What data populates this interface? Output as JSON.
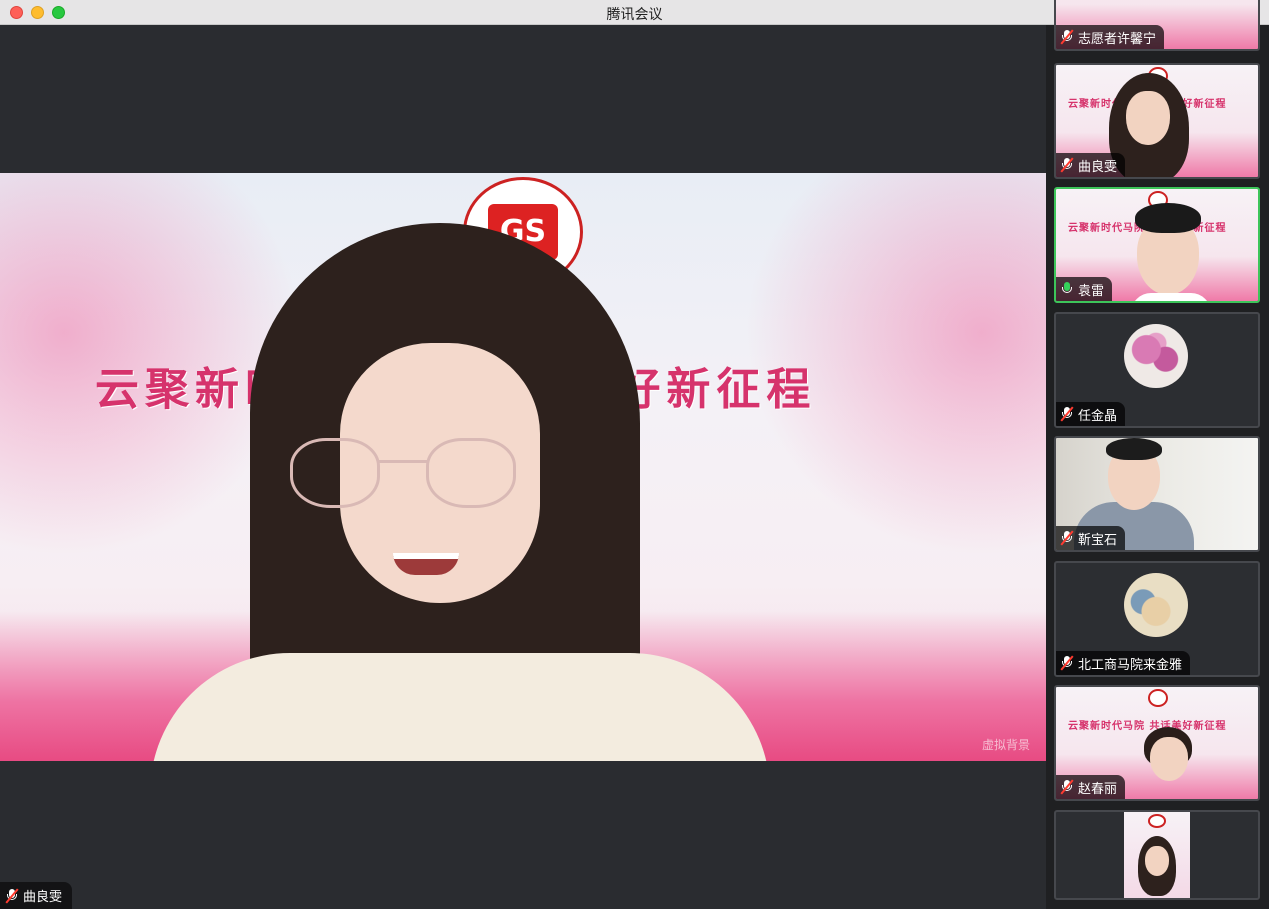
{
  "window": {
    "title": "腾讯会议"
  },
  "main_video": {
    "banner_text": "云聚新时代马院  共话美好新征程",
    "logo_text": "GS",
    "watermark": "虚拟背景",
    "speaker_name": "曲良雯",
    "speaker_muted": true
  },
  "participants": [
    {
      "name": "志愿者许馨宁",
      "muted": true,
      "video": "banner"
    },
    {
      "name": "曲良雯",
      "muted": true,
      "video": "banner-woman"
    },
    {
      "name": "袁雷",
      "muted": false,
      "speaking": true,
      "video": "banner-man"
    },
    {
      "name": "任金晶",
      "muted": true,
      "video": "avatar-flower"
    },
    {
      "name": "靳宝石",
      "muted": true,
      "video": "room-man"
    },
    {
      "name": "北工商马院来金雅",
      "muted": true,
      "video": "avatar-photo"
    },
    {
      "name": "赵春丽",
      "muted": true,
      "video": "banner-woman2"
    },
    {
      "name": "",
      "muted": true,
      "video": "banner-portrait"
    }
  ],
  "tile_banner_texts": {
    "short": "云聚新时代马院  共话美好新征程"
  },
  "colors": {
    "active_speaker_border": "#3dc55a",
    "muted_icon": "#ff3b30",
    "banner_pink": "#d6336c"
  }
}
